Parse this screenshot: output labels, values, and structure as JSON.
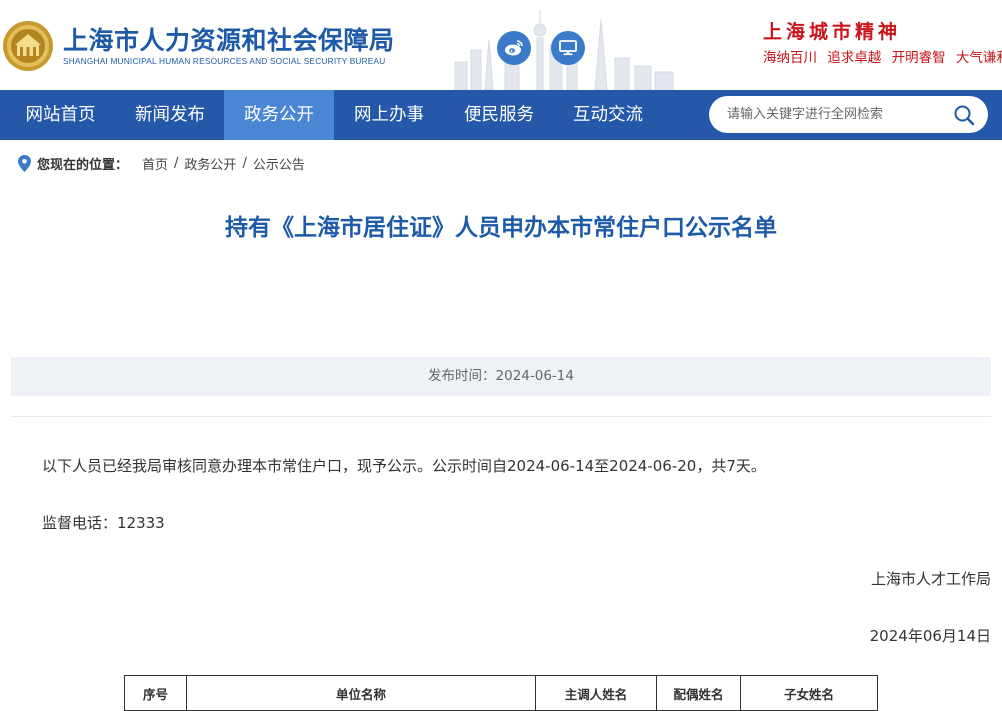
{
  "header": {
    "site_title": "上海市人力资源和社会保障局",
    "site_subtitle": "SHANGHAI MUNICIPAL HUMAN RESOURCES AND SOCIAL SECURITY BUREAU",
    "spirit_title": "上海城市精神",
    "spirit_phrases": [
      "海纳百川",
      "追求卓越",
      "开明睿智",
      "大气谦和"
    ],
    "icons": {
      "weibo": "weibo-icon",
      "pc": "desktop-icon"
    }
  },
  "nav": {
    "items": [
      {
        "label": "网站首页"
      },
      {
        "label": "新闻发布"
      },
      {
        "label": "政务公开",
        "active": true
      },
      {
        "label": "网上办事"
      },
      {
        "label": "便民服务"
      },
      {
        "label": "互动交流"
      }
    ],
    "search_placeholder": "请输入关键字进行全网检索"
  },
  "breadcrumb": {
    "label": "您现在的位置：",
    "items": [
      "首页",
      "政务公开",
      "公示公告"
    ],
    "separator": "/"
  },
  "article": {
    "title": "持有《上海市居住证》人员申办本市常住户口公示名单",
    "publish_label": "发布时间：",
    "publish_date": "2024-06-14",
    "intro": "以下人员已经我局审核同意办理本市常住户口，现予公示。公示时间自2024-06-14至2024-06-20，共7天。",
    "hotline": "监督电话：12333",
    "signer": "上海市人才工作局",
    "sign_date": "2024年06月14日"
  },
  "table": {
    "headers": [
      "序号",
      "单位名称",
      "主调人姓名",
      "配偶姓名",
      "子女姓名"
    ]
  },
  "colors": {
    "brand_blue": "#1d5aa8",
    "nav_bg": "#2558a8",
    "nav_active": "#4a86d4",
    "accent_red": "#c8141a"
  }
}
